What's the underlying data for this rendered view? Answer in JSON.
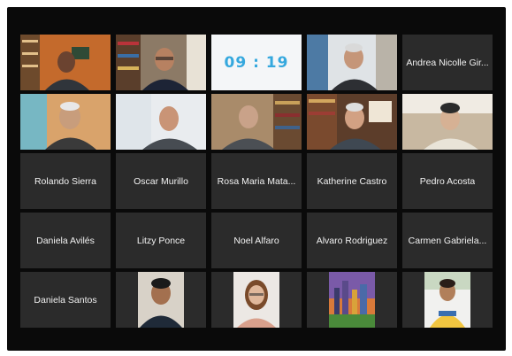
{
  "timer": "09 : 19",
  "participants": {
    "video": [
      {
        "name": "",
        "bg": "#c46a2c",
        "skin": "#6b4330",
        "shirt": "#30353b",
        "extra": "bookshelf"
      },
      {
        "name": "",
        "bg": "#8c7a66",
        "skin": "#b78161",
        "shirt": "#1d2436",
        "extra": "bookshelf"
      },
      {
        "name": "",
        "bg": "#e8eaec",
        "skin": "#dbb5a0",
        "shirt": "#2a2d33",
        "extra": "window"
      },
      {
        "name": "",
        "bg": "#4d7aa4",
        "skin": "#c59679",
        "shirt": "#2d2f33",
        "extra": "window"
      },
      {
        "name": "",
        "bg": "#77b7c3",
        "skin": "#c89d7c",
        "shirt": "#3a3a3a",
        "extra": "wall"
      },
      {
        "name": "",
        "bg": "#5c3d2a",
        "skin": "#c99476",
        "shirt": "#474c52",
        "extra": "wall"
      },
      {
        "name": "",
        "bg": "#a98b6a",
        "skin": "#c9a289",
        "shirt": "#4b4f54",
        "extra": "bookshelf"
      },
      {
        "name": "",
        "bg": "#c8b8a1",
        "skin": "#d6b194",
        "shirt": "#e9e4d8",
        "extra": "window"
      }
    ],
    "name_row_top_right": "Andrea Nicolle Gir...",
    "name_rows": [
      [
        "Rolando Sierra",
        "Oscar Murillo",
        "Rosa Maria Mata...",
        "Katherine Castro",
        "Pedro Acosta"
      ],
      [
        "Daniela Avilés",
        "Litzy Ponce",
        "Noel Alfaro",
        "Alvaro Rodriguez",
        "Carmen Gabriela..."
      ]
    ],
    "last_row_name": "Daniela Santos"
  },
  "colors": {
    "tile_bg": "#2b2b2b",
    "screen_bg": "#0a0a0a",
    "active_speaker_border": "#e7d44a",
    "timer_text": "#35a8de"
  }
}
